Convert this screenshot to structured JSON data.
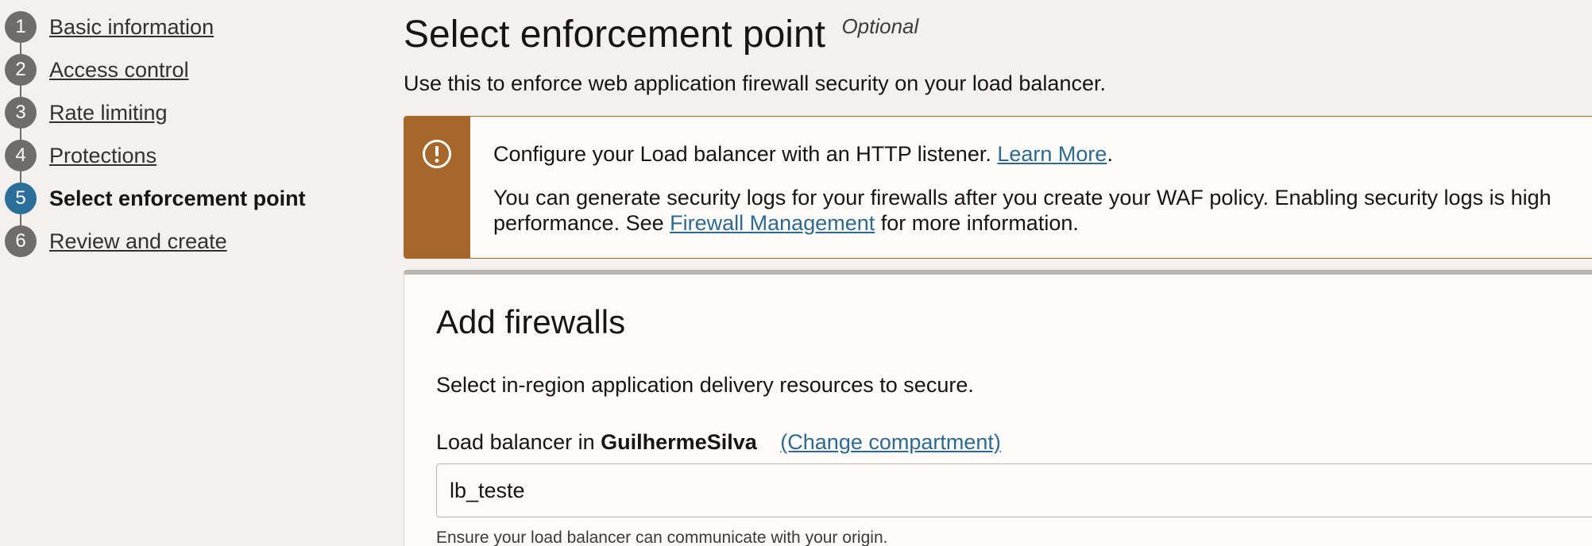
{
  "steps": [
    {
      "number": "1",
      "label": "Basic information"
    },
    {
      "number": "2",
      "label": "Access control"
    },
    {
      "number": "3",
      "label": "Rate limiting"
    },
    {
      "number": "4",
      "label": "Protections"
    },
    {
      "number": "5",
      "label": "Select enforcement point",
      "current": true
    },
    {
      "number": "6",
      "label": "Review and create"
    }
  ],
  "page": {
    "title": "Select enforcement point",
    "optional": "Optional",
    "subtitle": "Use this to enforce web application firewall security on your load balancer."
  },
  "banner": {
    "icon": "exclamation-circle-icon",
    "accent_color": "#a5682a",
    "line1_text": "Configure your Load balancer with an HTTP listener.",
    "line1_link": "Learn More",
    "line1_end": ".",
    "line2_text": "You can generate security logs for your firewalls after you create your WAF policy. Enabling security logs is high",
    "line3_text": "performance. See",
    "line3_link": "Firewall Management",
    "line3_end": "for more information."
  },
  "card": {
    "title": "Add firewalls",
    "description": "Select in-region application delivery resources to secure.",
    "field_label": "Load balancer in",
    "compartment": "GuilhermeSilva",
    "change_link": "(Change compartment)",
    "input_value": "lb_teste",
    "helper": "Ensure your load balancer can communicate with your origin."
  },
  "colors": {
    "current_step": "#2b6e9a",
    "step_default": "#6f6c69",
    "link": "#2e6a8e"
  }
}
